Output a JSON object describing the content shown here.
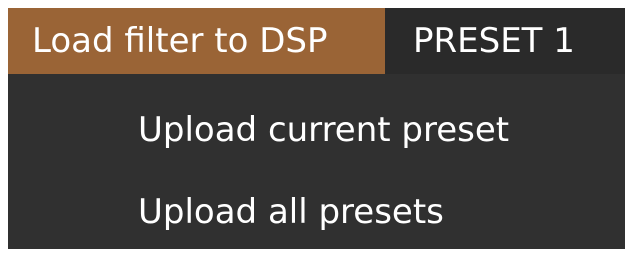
{
  "menu": {
    "title": "Load filter to DSP",
    "preset_label": "PRESET 1",
    "items": [
      {
        "label": "Upload current preset"
      },
      {
        "label": "Upload all presets"
      }
    ]
  },
  "colors": {
    "menu_title_active_bg": "#9a6436",
    "menubar_bg": "#2a2a2a",
    "dropdown_bg": "#303030",
    "text": "#ffffff",
    "page_bg": "#ffffff"
  }
}
